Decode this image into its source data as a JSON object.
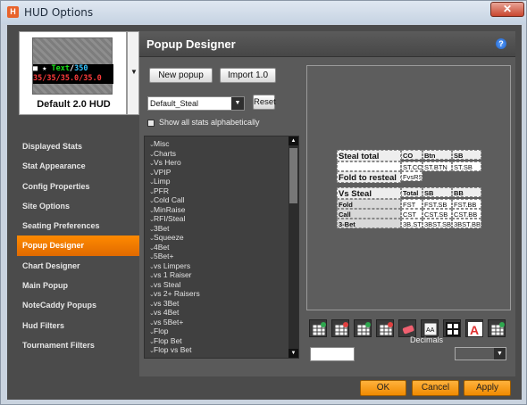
{
  "window": {
    "title": "HUD Options",
    "icon": "app-logo-icon",
    "close_glyph": "✕"
  },
  "hud": {
    "preview_line1_parts": [
      {
        "text": "■",
        "color": "#ffffff"
      },
      {
        "text": " ★ ",
        "color": "#ffffff"
      },
      {
        "text": "Text",
        "color": "#19e019"
      },
      {
        "text": "/",
        "color": "#ffffff"
      },
      {
        "text": "350",
        "color": "#35c4ff"
      }
    ],
    "preview_line2": "35/35/35.0/35.0",
    "preview_line2_color": "#ff3b3b",
    "name": "Default 2.0 HUD"
  },
  "nav": {
    "items": [
      {
        "label": "Displayed Stats",
        "active": false
      },
      {
        "label": "Stat Appearance",
        "active": false
      },
      {
        "label": "Config Properties",
        "active": false
      },
      {
        "label": "Site Options",
        "active": false
      },
      {
        "label": "Seating Preferences",
        "active": false
      },
      {
        "label": "Popup Designer",
        "active": true
      },
      {
        "label": "Chart Designer",
        "active": false
      },
      {
        "label": "Main Popup",
        "active": false
      },
      {
        "label": "NoteCaddy Popups",
        "active": false
      },
      {
        "label": "Hud Filters",
        "active": false
      },
      {
        "label": "Tournament Filters",
        "active": false
      }
    ]
  },
  "panel": {
    "title": "Popup Designer",
    "help_glyph": "?",
    "new_popup_label": "New popup",
    "import_label": "Import 1.0",
    "popup_select_value": "Default_Steal",
    "reset_label": "Reset",
    "show_all_label": "Show all stats alphabetically",
    "decimals_label": "Decimals"
  },
  "stat_list": [
    "Misc",
    "Charts",
    "Vs Hero",
    "VPIP",
    "Limp",
    "PFR",
    "Cold Call",
    "MinRaise",
    "RFI/Steal",
    "3Bet",
    "Squeeze",
    "4Bet",
    "5Bet+",
    "vs Limpers",
    "vs 1 Raiser",
    "vs Steal",
    "vs 2+ Raisers",
    "vs 3Bet",
    "vs 4Bet",
    "vs 5Bet+",
    "Flop",
    "Flop Bet",
    "Flop vs Bet"
  ],
  "popup_grid": {
    "section1": {
      "header": [
        "Steal total",
        "CO",
        "Btn",
        "SB"
      ],
      "rows": [
        [
          "",
          "ST.CO",
          "ST.BTN",
          "ST.SB"
        ]
      ],
      "fold_label": "Fold to resteal",
      "fold_value": "FvsRS"
    },
    "section2": {
      "header": [
        "Vs Steal",
        "Total",
        "SB",
        "BB"
      ],
      "rows": [
        [
          "Fold",
          "FST",
          "FST.SB",
          "FST.BB"
        ],
        [
          "Call",
          "CST",
          "CST.SB",
          "CST.BB"
        ],
        [
          "3-Bet",
          "3B.ST",
          "3BST.SB",
          "3BST.BB"
        ]
      ]
    }
  },
  "toolbar": {
    "icons": [
      "add-row-icon",
      "delete-row-icon",
      "add-column-icon",
      "delete-column-icon",
      "eraser-icon",
      "font-size-icon",
      "borders-icon",
      "text-color-icon",
      "merge-cells-icon"
    ]
  },
  "footer": {
    "ok_label": "OK",
    "cancel_label": "Cancel",
    "apply_label": "Apply"
  },
  "colors": {
    "accent": "#f08a00",
    "panel_bg": "#5a5a5a",
    "sidebar_bg": "#4b4b4b"
  }
}
